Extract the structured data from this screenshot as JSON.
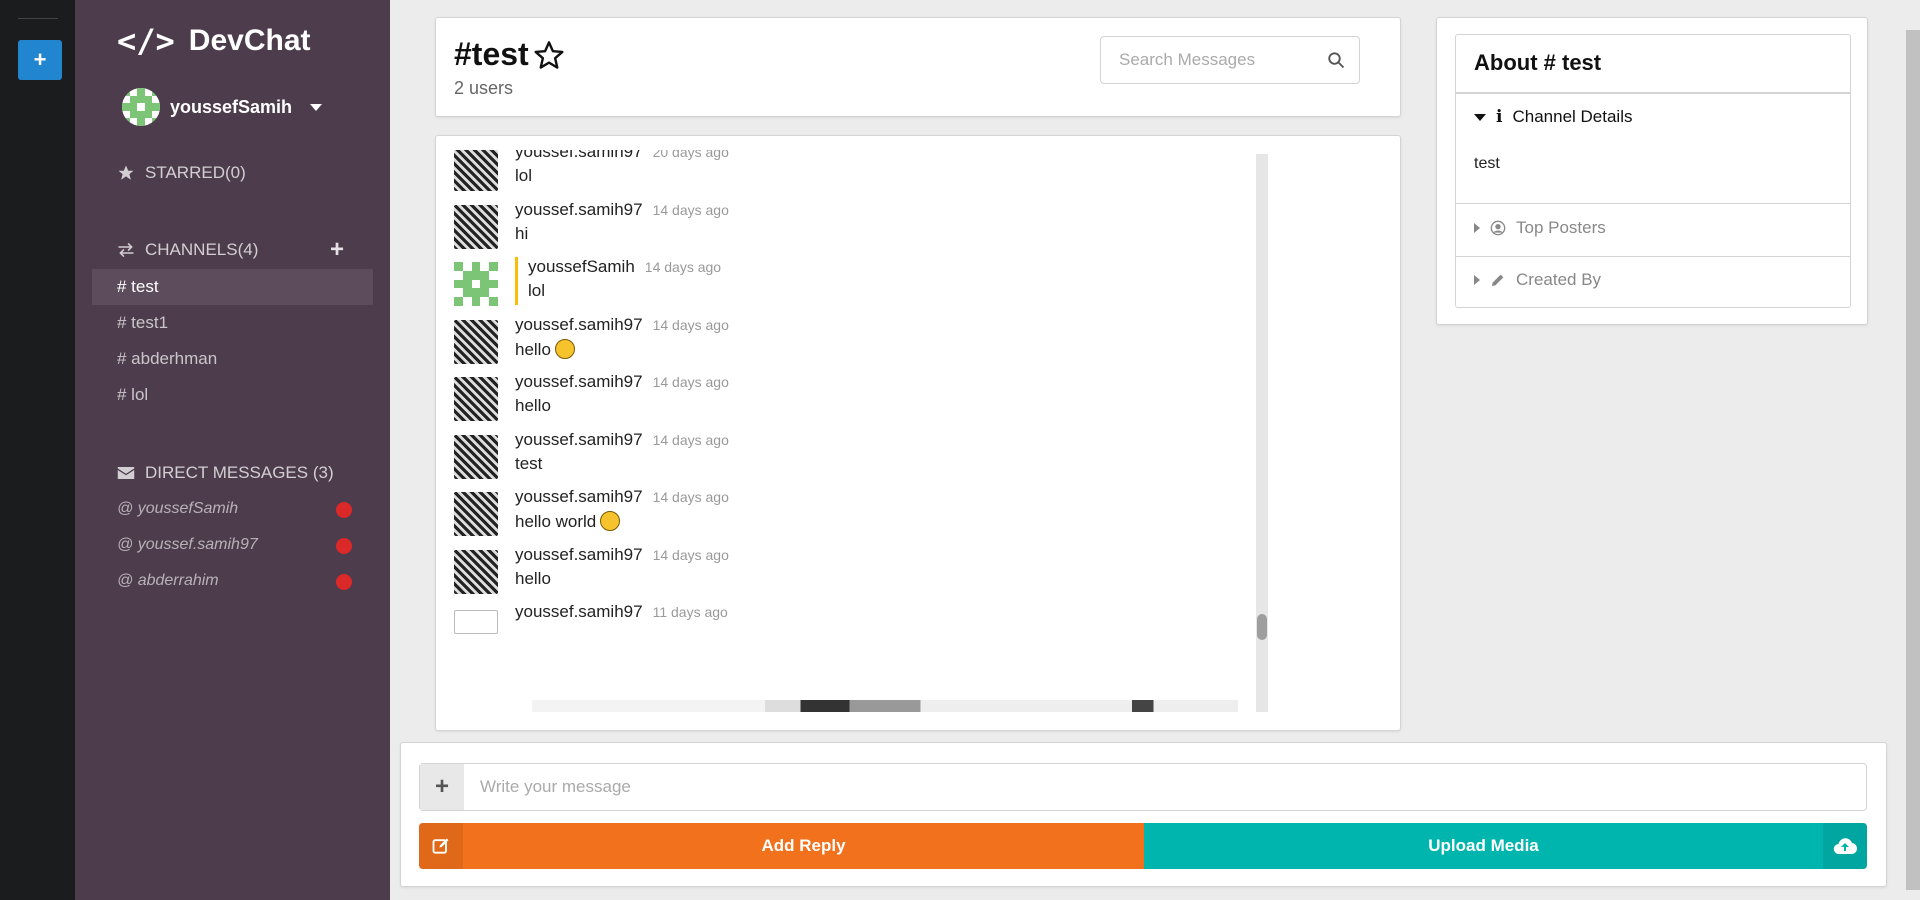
{
  "app": {
    "name": "DevChat",
    "logo_glyph": "</>"
  },
  "rail": {
    "add_label": "+"
  },
  "user": {
    "name": "youssefSamih"
  },
  "starred": {
    "label": "STARRED(0)"
  },
  "channels": {
    "label": "CHANNELS(4)",
    "add_label": "+",
    "items": [
      {
        "label": "# test",
        "active": true
      },
      {
        "label": "# test1",
        "active": false
      },
      {
        "label": "# abderhman",
        "active": false
      },
      {
        "label": "# lol",
        "active": false
      }
    ]
  },
  "direct_messages": {
    "label": "DIRECT MESSAGES (3)",
    "items": [
      {
        "label": "@ youssefSamih",
        "status_color": "#db2828"
      },
      {
        "label": "@ youssef.samih97",
        "status_color": "#db2828"
      },
      {
        "label": "@ abderrahim",
        "status_color": "#db2828"
      }
    ]
  },
  "header": {
    "title": "#test",
    "users": "2 users",
    "search_placeholder": "Search Messages"
  },
  "messages": [
    {
      "user": "youssef.samih97",
      "time": "20 days ago",
      "text": "lol",
      "own": false,
      "avatar": "photo",
      "emoji": ""
    },
    {
      "user": "youssef.samih97",
      "time": "14 days ago",
      "text": "hi",
      "own": false,
      "avatar": "photo",
      "emoji": ""
    },
    {
      "user": "youssefSamih",
      "time": "14 days ago",
      "text": "lol",
      "own": true,
      "avatar": "identicon",
      "emoji": ""
    },
    {
      "user": "youssef.samih97",
      "time": "14 days ago",
      "text": "hello",
      "own": false,
      "avatar": "photo",
      "emoji": "grin"
    },
    {
      "user": "youssef.samih97",
      "time": "14 days ago",
      "text": "hello",
      "own": false,
      "avatar": "photo",
      "emoji": ""
    },
    {
      "user": "youssef.samih97",
      "time": "14 days ago",
      "text": "test",
      "own": false,
      "avatar": "photo",
      "emoji": ""
    },
    {
      "user": "youssef.samih97",
      "time": "14 days ago",
      "text": "hello world",
      "own": false,
      "avatar": "photo",
      "emoji": "tongue"
    },
    {
      "user": "youssef.samih97",
      "time": "14 days ago",
      "text": "hello",
      "own": false,
      "avatar": "photo",
      "emoji": ""
    },
    {
      "user": "youssef.samih97",
      "time": "11 days ago",
      "text": "",
      "own": false,
      "avatar": "broken",
      "emoji": ""
    }
  ],
  "about": {
    "title": "About # test",
    "channel_details": {
      "label": "Channel Details",
      "text": "test"
    },
    "top_posters": {
      "label": "Top Posters"
    },
    "created_by": {
      "label": "Created By"
    }
  },
  "composer": {
    "add_label": "+",
    "placeholder": "Write your message",
    "reply_label": "Add Reply",
    "upload_label": "Upload Media"
  },
  "colors": {
    "sidebar": "#4c3c4c",
    "rail": "#1b1c1d",
    "reply": "#f2711c",
    "upload": "#00b5ad",
    "own_message_bar": "#fbbd08",
    "identicon": "#7cc576"
  }
}
